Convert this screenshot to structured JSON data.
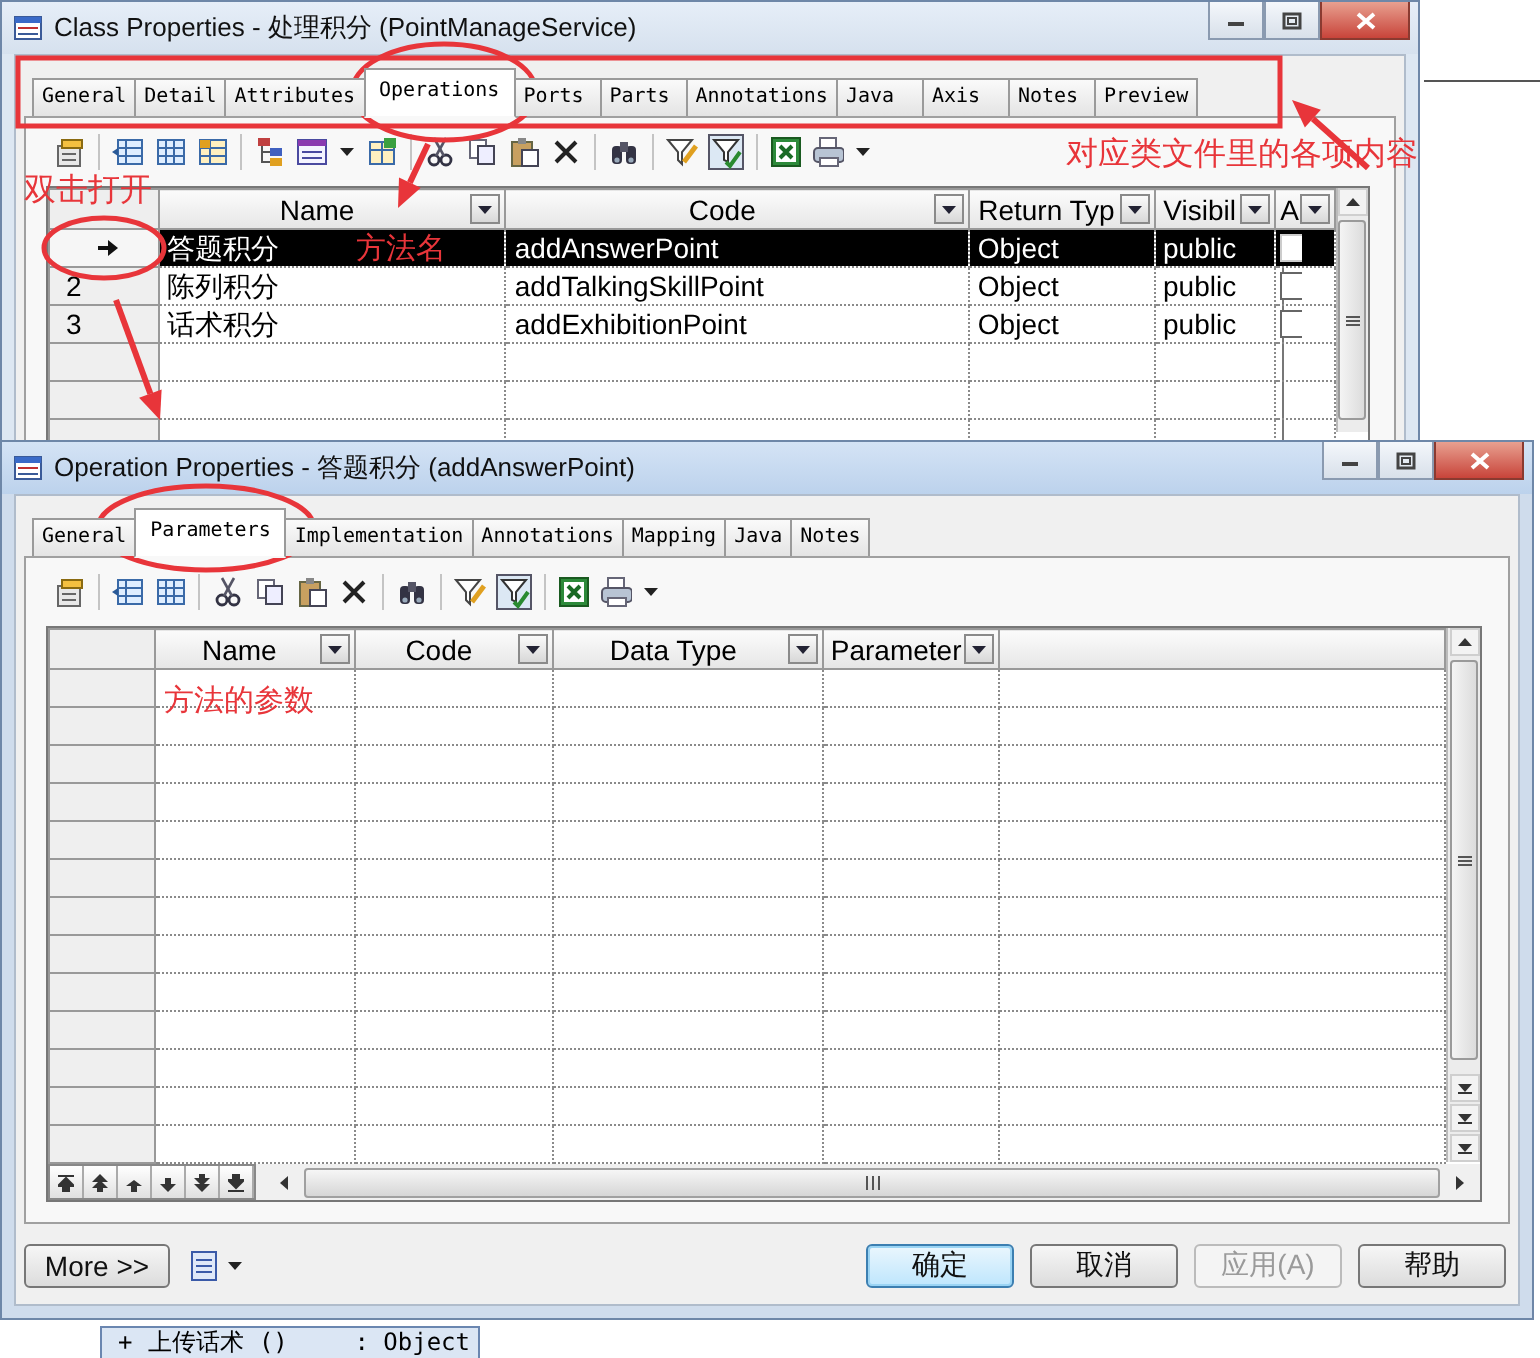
{
  "class_window": {
    "title": "Class Properties - 处理积分 (PointManageService)",
    "tabs": [
      {
        "label": "General",
        "selected": false
      },
      {
        "label": "Detail",
        "selected": false
      },
      {
        "label": "Attributes",
        "selected": false
      },
      {
        "label": "Operations",
        "selected": true
      },
      {
        "label": "Ports",
        "selected": false
      },
      {
        "label": "Parts",
        "selected": false
      },
      {
        "label": "Annotations",
        "selected": false
      },
      {
        "label": "Java",
        "selected": false
      },
      {
        "label": "Axis",
        "selected": false
      },
      {
        "label": "Notes",
        "selected": false
      },
      {
        "label": "Preview",
        "selected": false
      }
    ],
    "columns": [
      "Name",
      "Code",
      "Return Typ",
      "Visibil",
      "A"
    ],
    "rows": [
      {
        "name": "答题积分",
        "code": "addAnswerPoint",
        "return_type": "Object",
        "visibility": "public",
        "a_checked": false,
        "selected": true
      },
      {
        "number": "2",
        "name": "陈列积分",
        "code": "addTalkingSkillPoint",
        "return_type": "Object",
        "visibility": "public",
        "a_checked": false,
        "selected": false
      },
      {
        "number": "3",
        "name": "话术积分",
        "code": "addExhibitionPoint",
        "return_type": "Object",
        "visibility": "public",
        "a_checked": false,
        "selected": false
      }
    ]
  },
  "operation_window": {
    "title": "Operation Properties - 答题积分 (addAnswerPoint)",
    "tabs": [
      {
        "label": "General",
        "selected": false
      },
      {
        "label": "Parameters",
        "selected": true
      },
      {
        "label": "Implementation",
        "selected": false
      },
      {
        "label": "Annotations",
        "selected": false
      },
      {
        "label": "Mapping",
        "selected": false
      },
      {
        "label": "Java",
        "selected": false
      },
      {
        "label": "Notes",
        "selected": false
      }
    ],
    "columns": [
      "Name",
      "Code",
      "Data Type",
      "Parameter"
    ],
    "more_button": "More >>",
    "buttons": [
      {
        "label": "确定",
        "default": true,
        "disabled": false
      },
      {
        "label": "取消",
        "default": false,
        "disabled": false
      },
      {
        "label": "应用(A)",
        "default": false,
        "disabled": true
      },
      {
        "label": "帮助",
        "default": false,
        "disabled": false
      }
    ]
  },
  "annotations": [
    "对应类文件里的各项内容",
    "双击打开",
    "方法名",
    "方法的参数"
  ],
  "background_item": {
    "sign": "+",
    "name": "上传话术 ()",
    "type": ": Object"
  }
}
